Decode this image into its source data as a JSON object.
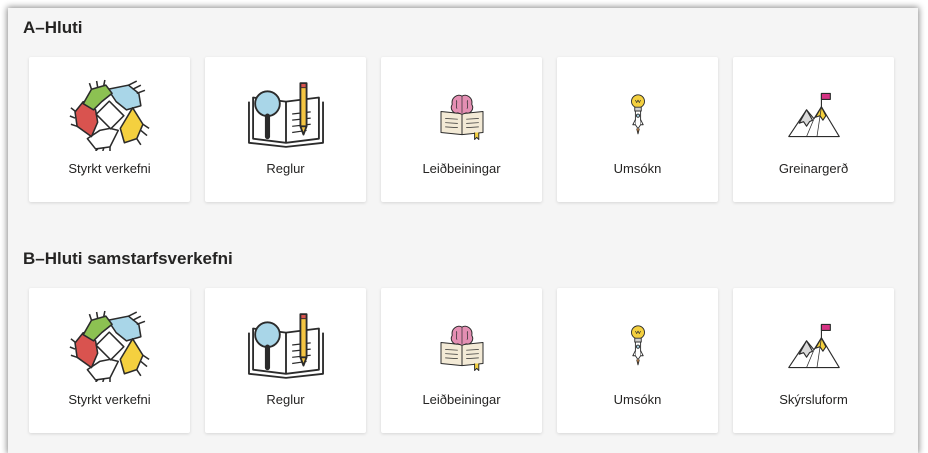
{
  "sections": [
    {
      "title": "A–Hluti",
      "cards": [
        {
          "label": "Styrkt verkefni",
          "icon": "hands-circle-icon"
        },
        {
          "label": "Reglur",
          "icon": "book-magnifier-pencil-icon"
        },
        {
          "label": "Leiðbeiningar",
          "icon": "book-brain-icon"
        },
        {
          "label": "Umsókn",
          "icon": "lightbulb-rocket-icon"
        },
        {
          "label": "Greinargerð",
          "icon": "mountain-flag-icon"
        }
      ]
    },
    {
      "title": "B–Hluti samstarfsverkefni",
      "cards": [
        {
          "label": "Styrkt verkefni",
          "icon": "hands-circle-icon"
        },
        {
          "label": "Reglur",
          "icon": "book-magnifier-pencil-icon"
        },
        {
          "label": "Leiðbeiningar",
          "icon": "book-brain-icon"
        },
        {
          "label": "Umsókn",
          "icon": "lightbulb-rocket-icon"
        },
        {
          "label": "Skýrsluform",
          "icon": "mountain-flag-icon"
        }
      ]
    }
  ],
  "colors": {
    "background": "#f5f5f5",
    "card": "#ffffff",
    "text": "#252423"
  }
}
